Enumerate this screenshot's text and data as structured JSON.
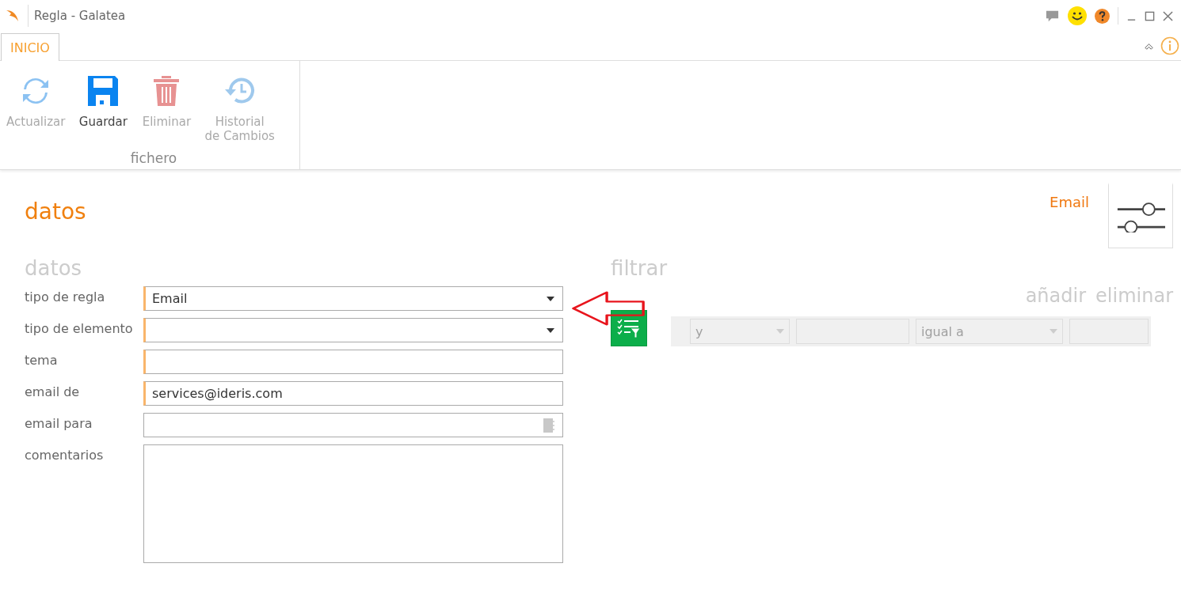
{
  "window": {
    "title": "Regla - Galatea"
  },
  "tabs": [
    {
      "label": "INICIO",
      "selected": true
    }
  ],
  "ribbon": {
    "group": "fichero",
    "buttons": [
      {
        "label": "Actualizar",
        "kind": "refresh",
        "disabled": true
      },
      {
        "label": "Guardar",
        "kind": "save",
        "disabled": false
      },
      {
        "label": "Eliminar",
        "kind": "delete",
        "disabled": true
      },
      {
        "label": "Historial\nde Cambios",
        "kind": "history",
        "disabled": true
      }
    ]
  },
  "page": {
    "title": "datos",
    "mode_label": "Email"
  },
  "form": {
    "title": "datos",
    "fields": [
      {
        "label": "tipo de regla",
        "kind": "dropdown",
        "value": "Email",
        "required": true
      },
      {
        "label": "tipo de elemento",
        "kind": "dropdown",
        "required": true
      },
      {
        "label": "tema",
        "kind": "text",
        "required": true
      },
      {
        "label": "email de",
        "kind": "text",
        "value": "services@ideris.com",
        "required": true
      },
      {
        "label": "email para",
        "kind": "lookup",
        "required": false
      },
      {
        "label": "comentarios",
        "kind": "textarea",
        "required": false
      }
    ]
  },
  "filter": {
    "title": "filtrar",
    "actions": [
      "añadir",
      "eliminar"
    ],
    "row": {
      "connector": "y",
      "operator": "igual a"
    }
  }
}
